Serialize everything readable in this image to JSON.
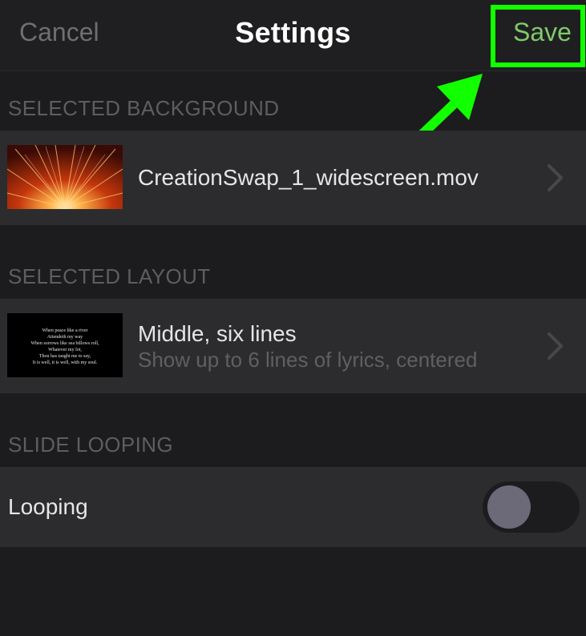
{
  "navbar": {
    "cancel_label": "Cancel",
    "title": "Settings",
    "save_label": "Save"
  },
  "background_section": {
    "header": "SELECTED BACKGROUND",
    "file_name": "CreationSwap_1_widescreen.mov",
    "thumbnail_icon": "fireburst-thumbnail",
    "chevron_icon": "chevron-right-icon"
  },
  "layout_section": {
    "header": "SELECTED LAYOUT",
    "title": "Middle, six lines",
    "subtitle": "Show up to 6 lines of lyrics, centered",
    "preview_lines": [
      "When peace like a river",
      "Attendeth my way",
      "When sorrows like sea billows roll,",
      "Whatever my lot,",
      "Thou has taught me to say,",
      "It is well, it is well, with my soul."
    ],
    "chevron_icon": "chevron-right-icon"
  },
  "looping_section": {
    "header": "SLIDE LOOPING",
    "label": "Looping",
    "toggle_on": false
  },
  "colors": {
    "accent_save": "#7fc96a",
    "highlight": "#12ff00",
    "background": "#1c1c1e",
    "cell": "#2c2c2e"
  }
}
